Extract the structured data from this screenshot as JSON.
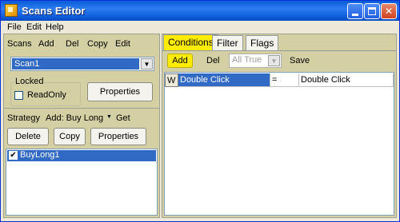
{
  "window": {
    "title": "Scans Editor"
  },
  "menu": [
    "File",
    "Edit",
    "Help"
  ],
  "scans": {
    "label": "Scans",
    "add": "Add",
    "del": "Del",
    "copy": "Copy",
    "edit": "Edit",
    "selected_scan": "Scan1",
    "locked_label": "Locked",
    "readonly_label": "ReadOnly",
    "readonly_checked": false,
    "properties": "Properties"
  },
  "strategy": {
    "label": "Strategy",
    "add_label": "Add: Buy Long",
    "get": "Get",
    "delete": "Delete",
    "copy": "Copy",
    "properties": "Properties",
    "items": [
      {
        "name": "BuyLong1",
        "checked": true
      }
    ]
  },
  "tabs": [
    "Conditions",
    "Filter",
    "Flags"
  ],
  "conditions": {
    "add": "Add",
    "del": "Del",
    "filter_select": "All True",
    "save": "Save",
    "rows": [
      {
        "marker": "W",
        "field": "Double Click",
        "op": "=",
        "value": "Double Click"
      }
    ]
  },
  "colors": {
    "accent_yellow": "#ffec00",
    "selection_blue": "#316ac5",
    "title_blue": "#0a5bd8"
  }
}
